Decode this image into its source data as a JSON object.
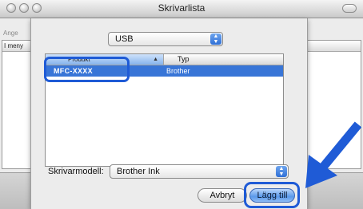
{
  "window": {
    "title": "Skrivarlista"
  },
  "background": {
    "left_label": "Ange",
    "header_label": "I meny"
  },
  "sheet": {
    "connection_popup": {
      "value": "USB"
    },
    "list": {
      "columns": [
        "Produkt",
        "Typ"
      ],
      "rows": [
        {
          "product": "MFC-XXXX",
          "type": "Brother",
          "selected": true
        }
      ]
    },
    "model": {
      "label": "Skrivarmodell:",
      "value": "Brother Ink"
    },
    "buttons": {
      "cancel": "Avbryt",
      "add": "Lägg till"
    }
  },
  "annotations": {
    "callout_color": "#1f5bd6",
    "selection_color": "#3875d7"
  },
  "icons": [
    "close-icon",
    "minimize-icon",
    "zoom-icon",
    "popup-arrows-icon",
    "sort-arrow-icon",
    "pointer-arrow-icon"
  ]
}
